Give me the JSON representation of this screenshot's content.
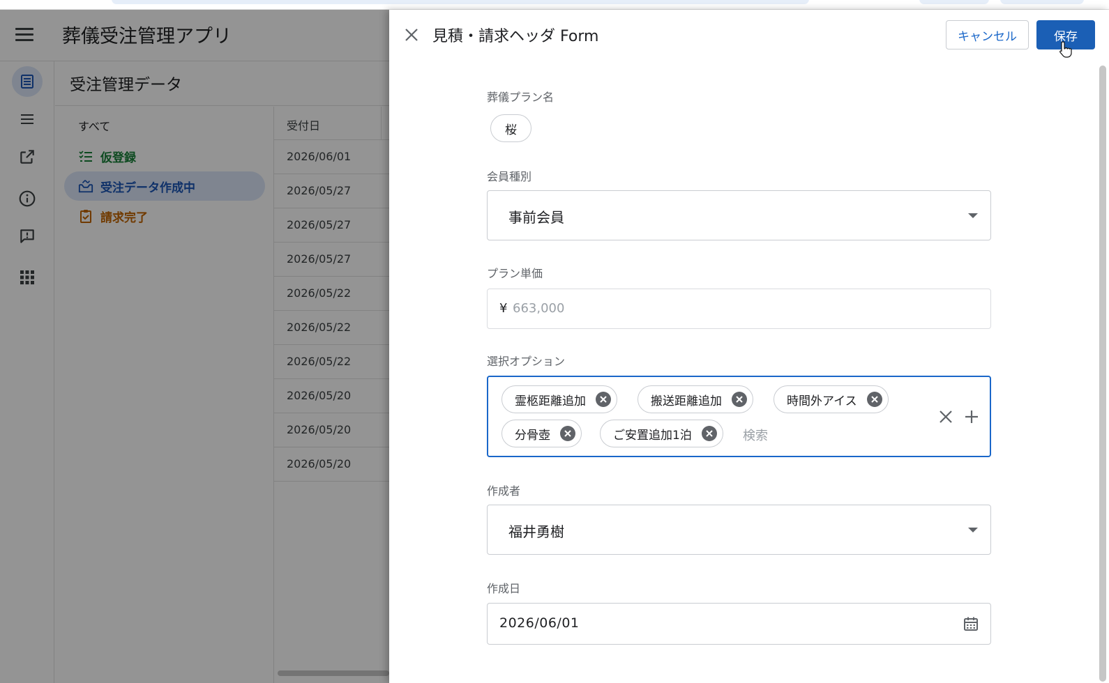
{
  "app": {
    "title": "葬儀受注管理アプリ"
  },
  "page": {
    "title": "受注管理データ"
  },
  "nav": {
    "all_label": "すべて",
    "items": [
      {
        "label": "仮登録",
        "color": "#188038",
        "icon": "checklist-icon"
      },
      {
        "label": "受注データ作成中",
        "color": "#1a55b5",
        "icon": "pending-tray-icon"
      },
      {
        "label": "請求完了",
        "color": "#c26401",
        "icon": "clipboard-check-icon"
      }
    ]
  },
  "rail": {
    "icons": [
      "table-icon",
      "list-icon",
      "external-link-icon",
      "info-icon",
      "feedback-icon",
      "apps-grid-icon"
    ]
  },
  "table": {
    "header": "受付日",
    "rows": [
      "2026/06/01",
      "2026/05/27",
      "2026/05/27",
      "2026/05/27",
      "2026/05/22",
      "2026/05/22",
      "2026/05/22",
      "2026/05/20",
      "2026/05/20",
      "2026/05/20"
    ]
  },
  "form": {
    "title": "見積・請求ヘッダ Form",
    "cancel_label": "キャンセル",
    "save_label": "保存",
    "plan_name": {
      "label": "葬儀プラン名",
      "value": "桜"
    },
    "member_type": {
      "label": "会員種別",
      "value": "事前会員"
    },
    "plan_price": {
      "label": "プラン単価",
      "currency": "¥",
      "value": "663,000"
    },
    "options": {
      "label": "選択オプション",
      "selected": [
        "霊柩距離追加",
        "搬送距離追加",
        "時間外アイス",
        "分骨壺",
        "ご安置追加1泊"
      ],
      "search_placeholder": "検索"
    },
    "creator": {
      "label": "作成者",
      "value": "福井勇樹"
    },
    "created_date": {
      "label": "作成日",
      "value": "2026/06/01"
    }
  },
  "colors": {
    "accent": "#1b5fb5",
    "focus_border": "#1a67c9"
  }
}
